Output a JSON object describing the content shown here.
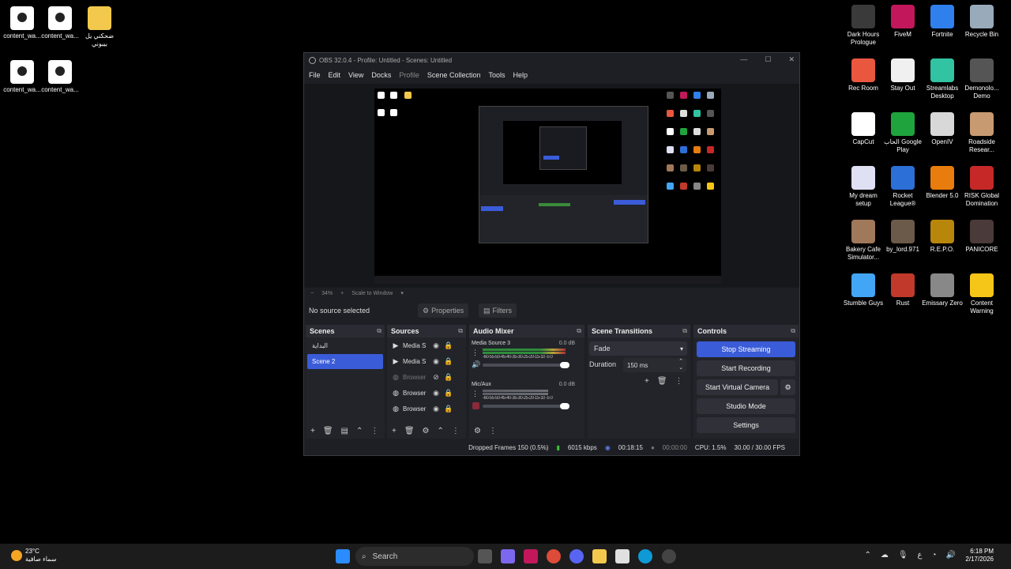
{
  "desktop": {
    "left_icons": [
      {
        "label": "content_wa...",
        "kind": "doc"
      },
      {
        "label": "content_wa...",
        "kind": "doc"
      },
      {
        "label": "ضحكني يل بيبوني",
        "kind": "folder"
      },
      {
        "label": "content_wa...",
        "kind": "doc"
      },
      {
        "label": "content_wa...",
        "kind": "doc"
      }
    ],
    "right_icons": [
      {
        "label": "Dark Hours Prologue",
        "color": "#3a3a3a"
      },
      {
        "label": "FiveM",
        "color": "#c2185b"
      },
      {
        "label": "Fortnite",
        "color": "#2f80ed"
      },
      {
        "label": "Recycle Bin",
        "color": "#9ab"
      },
      {
        "label": "Rec Room",
        "color": "#e9573f"
      },
      {
        "label": "Stay Out",
        "color": "#f0f0f0"
      },
      {
        "label": "Streamlabs Desktop",
        "color": "#31c3a2"
      },
      {
        "label": "Demonolo... Demo",
        "color": "#555"
      },
      {
        "label": "CapCut",
        "color": "#ffffff"
      },
      {
        "label": "الحاب Google Play",
        "color": "#1fa33c"
      },
      {
        "label": "OpenIV",
        "color": "#d8d8d8"
      },
      {
        "label": "Roadside Resear...",
        "color": "#c79a72"
      },
      {
        "label": "My dream setup",
        "color": "#e0e0f5"
      },
      {
        "label": "Rocket League®",
        "color": "#2c6fd6"
      },
      {
        "label": "Blender 5.0",
        "color": "#e87d0d"
      },
      {
        "label": "RISK Global Domination",
        "color": "#c62828"
      },
      {
        "label": "Bakery Cafe Simulator...",
        "color": "#a0785a"
      },
      {
        "label": "by_lord.971",
        "color": "#6b5a4a"
      },
      {
        "label": "R.E.P.O.",
        "color": "#b8860b"
      },
      {
        "label": "PANICORE",
        "color": "#4a3a3a"
      },
      {
        "label": "Stumble Guys",
        "color": "#42a5f5"
      },
      {
        "label": "Rust",
        "color": "#c0392b"
      },
      {
        "label": "Emissary Zero",
        "color": "#888"
      },
      {
        "label": "Content Warning",
        "color": "#f5c518"
      }
    ]
  },
  "obs": {
    "title": "OBS 32.0.4 - Profile: Untitled - Scenes: Untitled",
    "menu": [
      "File",
      "Edit",
      "View",
      "Docks",
      "Profile",
      "Scene Collection",
      "Tools",
      "Help"
    ],
    "zoom": "34%",
    "scale_mode": "Scale to Window",
    "no_source": "No source selected",
    "properties": "Properties",
    "filters": "Filters",
    "scenes": {
      "title": "Scenes",
      "items": [
        "البداية",
        "Scene 2"
      ],
      "selected": 1
    },
    "sources": {
      "title": "Sources",
      "items": [
        {
          "name": "Media S",
          "icon": "play",
          "visible": true
        },
        {
          "name": "Media S",
          "icon": "play",
          "visible": true
        },
        {
          "name": "Browser",
          "icon": "globe",
          "visible": false
        },
        {
          "name": "Browser",
          "icon": "globe",
          "visible": true
        },
        {
          "name": "Browser",
          "icon": "globe",
          "visible": true
        }
      ]
    },
    "mixer": {
      "title": "Audio Mixer",
      "channels": [
        {
          "name": "Media Source 3",
          "db": "0.0 dB",
          "level": 0.95
        },
        {
          "name": "Mic/Aux",
          "db": "0.0 dB",
          "level": 0.75
        }
      ],
      "scale": "-60-55-50-45-40-35-30-25-20-15-10 -5 0"
    },
    "transitions": {
      "title": "Scene Transitions",
      "type": "Fade",
      "duration_label": "Duration",
      "duration": "150 ms"
    },
    "controls": {
      "title": "Controls",
      "stop_streaming": "Stop Streaming",
      "start_recording": "Start Recording",
      "start_virtual_camera": "Start Virtual Camera",
      "studio_mode": "Studio Mode",
      "settings": "Settings"
    },
    "status": {
      "dropped": "Dropped Frames 150 (0.5%)",
      "bitrate": "6015 kbps",
      "stream_time": "00:18:15",
      "rec_time": "00:00:00",
      "cpu": "CPU: 1.5%",
      "fps": "30.00 / 30.00 FPS"
    }
  },
  "taskbar": {
    "temp": "23°C",
    "weather": "سماء صافية",
    "search": "Search",
    "lang": "ع",
    "time": "6:18 PM",
    "date": "2/17/2026"
  }
}
